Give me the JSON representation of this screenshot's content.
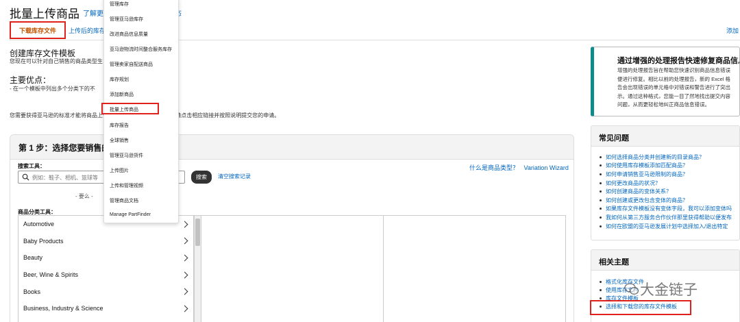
{
  "header": {
    "title": "批量上传商品",
    "learn_more": "了解更多",
    "learn_tail": "态"
  },
  "tabs": {
    "download": "下载库存文件",
    "uploaded": "上传后的库存文",
    "add": "添加"
  },
  "template": {
    "title": "创建库存文件模板",
    "desc": "您现在可以针对自己销售的商品类型生"
  },
  "advantages": {
    "title": "主要优点：",
    "item": "- 在一个模板中列出多个分类下的不"
  },
  "approval_note": "您需要获得亚马逊的标准才能将商品上传至                                                针对特定类别申请标准，请点击相应链接并按照说明提交您的申请。",
  "step1": {
    "title": "第 1 步：选择您要销售的商",
    "search_label": "搜索工具：",
    "search_placeholder": "例如：鞋子、相机、篮球等",
    "search_button": "搜索",
    "clear_history": "清空搜索记录",
    "what_is": "什么是商品类型？",
    "variation_wizard": "Variation Wizard",
    "or": "- 要么 -",
    "classifier_label": "商品分类工具：",
    "categories": [
      "Automotive",
      "Baby Products",
      "Beauty",
      "Beer, Wine & Spirits",
      "Books",
      "Business, Industry & Science"
    ]
  },
  "menu": {
    "items": [
      "管理库存",
      "管理亚马逊库存",
      "改进商品信息质量",
      "亚马逊物流时间整合服务库存",
      "管理卖家自配送商品",
      "库存规划",
      "添加新商品",
      "批量上传商品",
      "库存报告",
      "全球销售",
      "管理亚马逊货件",
      "上传图片",
      "上传和管理视频",
      "管理商品文档",
      "Manage PartFinder"
    ],
    "highlighted_index": 7
  },
  "promo": {
    "title": "通过增强的处理报告快速修复商品信息",
    "lines": [
      "增强的处理报告旨在帮助您快速识别商品信息错误",
      "便进行修复。相比以前的处理报告，新的 Excel 格",
      "告会出现错误的单元格中对错误和警告进行了突出",
      "示。通过这种格式，您能一目了然地找出提交内容",
      "问题，从而更轻松地纠正商品信息错误。"
    ]
  },
  "faq": {
    "title": "常见问题",
    "items": [
      "如何选择商品分类并创建新的目录商品？",
      "如何使用库存模板添加匹配商品？",
      "如何申请销售亚马逊限制的商品？",
      "如何更改商品的状况？",
      "如何创建商品的变体关系？",
      "如何创建或更改包含变体的商品？",
      "如果库存文件模板没有变体字段，我可以添加变体吗",
      "我如何从第三方服务合作伙伴那里获得帮助以便发布",
      "如何在欧盟的亚马逊发展计划中选择加入/退出特定"
    ]
  },
  "related": {
    "title": "相关主题",
    "items": [
      "格式化库存文件",
      "使用库存文件",
      "库存文件模板",
      "选择和下载您的库存文件模板"
    ]
  },
  "watermark": "大金链子",
  "colors": {
    "link": "#0066c0",
    "highlight_border": "#e0201b",
    "accent": "#0f8b8d"
  }
}
